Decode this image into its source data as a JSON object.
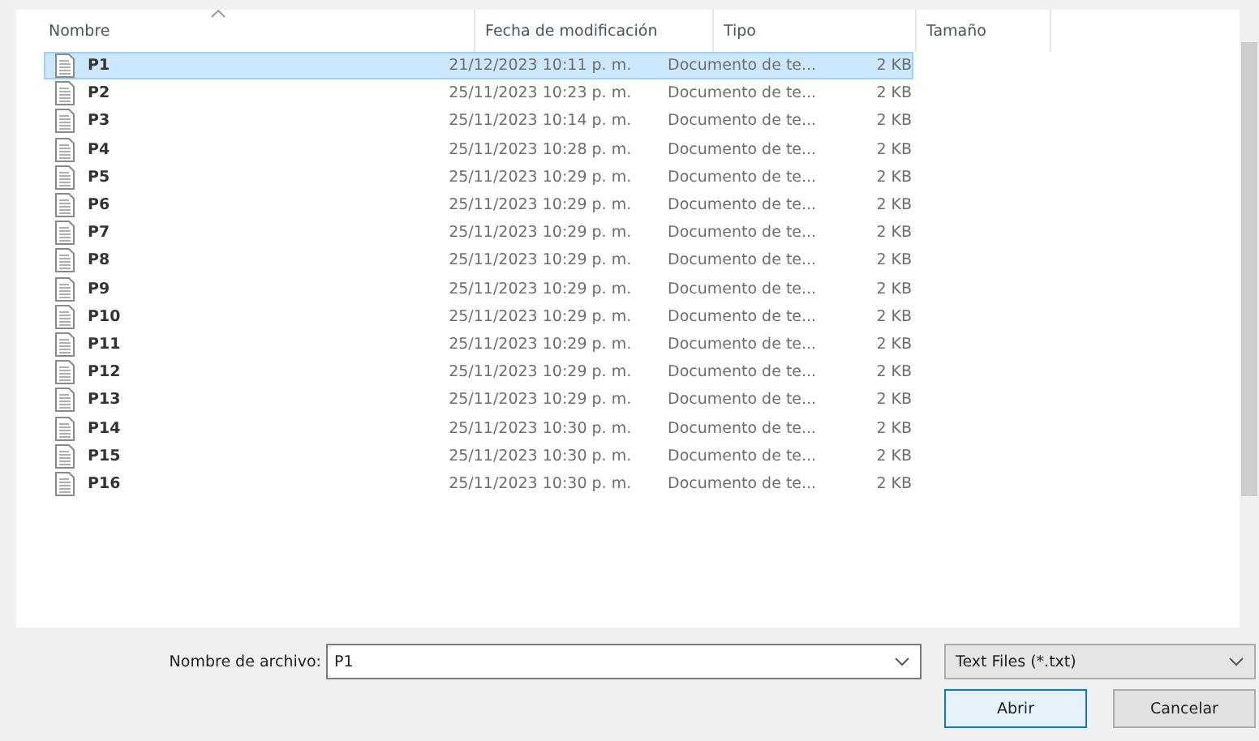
{
  "table": {
    "columns": [
      {
        "label": "Nombre",
        "sorted": true
      },
      {
        "label": "Fecha de modificación",
        "sorted": false
      },
      {
        "label": "Tipo",
        "sorted": false
      },
      {
        "label": "Tamaño",
        "sorted": false
      }
    ],
    "rows": [
      {
        "name": "P1",
        "date": "21/12/2023 10:11 p. m.",
        "type": "Documento de te...",
        "size": "2 KB",
        "selected": true
      },
      {
        "name": "P2",
        "date": "25/11/2023 10:23 p. m.",
        "type": "Documento de te...",
        "size": "2 KB",
        "selected": false
      },
      {
        "name": "P3",
        "date": "25/11/2023 10:14 p. m.",
        "type": "Documento de te...",
        "size": "2 KB",
        "selected": false
      },
      {
        "name": "P4",
        "date": "25/11/2023 10:28 p. m.",
        "type": "Documento de te...",
        "size": "2 KB",
        "selected": false
      },
      {
        "name": "P5",
        "date": "25/11/2023 10:29 p. m.",
        "type": "Documento de te...",
        "size": "2 KB",
        "selected": false
      },
      {
        "name": "P6",
        "date": "25/11/2023 10:29 p. m.",
        "type": "Documento de te...",
        "size": "2 KB",
        "selected": false
      },
      {
        "name": "P7",
        "date": "25/11/2023 10:29 p. m.",
        "type": "Documento de te...",
        "size": "2 KB",
        "selected": false
      },
      {
        "name": "P8",
        "date": "25/11/2023 10:29 p. m.",
        "type": "Documento de te...",
        "size": "2 KB",
        "selected": false
      },
      {
        "name": "P9",
        "date": "25/11/2023 10:29 p. m.",
        "type": "Documento de te...",
        "size": "2 KB",
        "selected": false
      },
      {
        "name": "P10",
        "date": "25/11/2023 10:29 p. m.",
        "type": "Documento de te...",
        "size": "2 KB",
        "selected": false
      },
      {
        "name": "P11",
        "date": "25/11/2023 10:29 p. m.",
        "type": "Documento de te...",
        "size": "2 KB",
        "selected": false
      },
      {
        "name": "P12",
        "date": "25/11/2023 10:29 p. m.",
        "type": "Documento de te...",
        "size": "2 KB",
        "selected": false
      },
      {
        "name": "P13",
        "date": "25/11/2023 10:29 p. m.",
        "type": "Documento de te...",
        "size": "2 KB",
        "selected": false
      },
      {
        "name": "P14",
        "date": "25/11/2023 10:30 p. m.",
        "type": "Documento de te...",
        "size": "2 KB",
        "selected": false
      },
      {
        "name": "P15",
        "date": "25/11/2023 10:30 p. m.",
        "type": "Documento de te...",
        "size": "2 KB",
        "selected": false
      },
      {
        "name": "P16",
        "date": "25/11/2023 10:30 p. m.",
        "type": "Documento de te...",
        "size": "2 KB",
        "selected": false
      }
    ]
  },
  "filename": {
    "label": "Nombre de archivo:",
    "value": "P1"
  },
  "filter": {
    "value": "Text Files (*.txt)"
  },
  "buttons": [
    {
      "label": "Abrir",
      "kind": "default"
    },
    {
      "label": "Cancelar",
      "kind": "normal"
    }
  ]
}
